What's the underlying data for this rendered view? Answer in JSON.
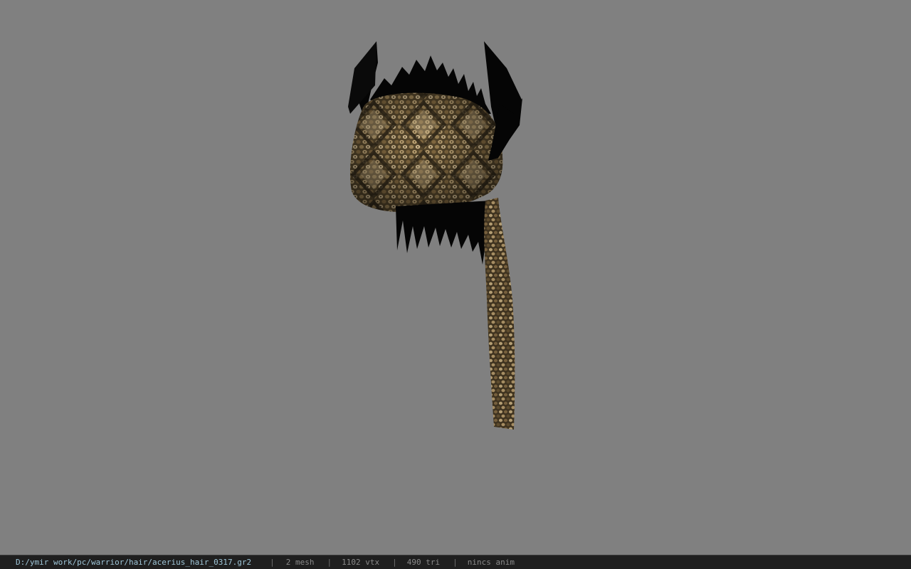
{
  "viewport": {
    "background_color": "#808080",
    "model_name": "snake-skin bandana hair mesh with black horns"
  },
  "status_bar": {
    "file_path": "D:/ymir work/pc/warrior/hair/acerius_hair_0317.gr2",
    "separator": "|",
    "mesh_count": "2 mesh",
    "vertex_count": "1102 vtx",
    "triangle_count": "490 tri",
    "anim_status": "nincs anim"
  }
}
